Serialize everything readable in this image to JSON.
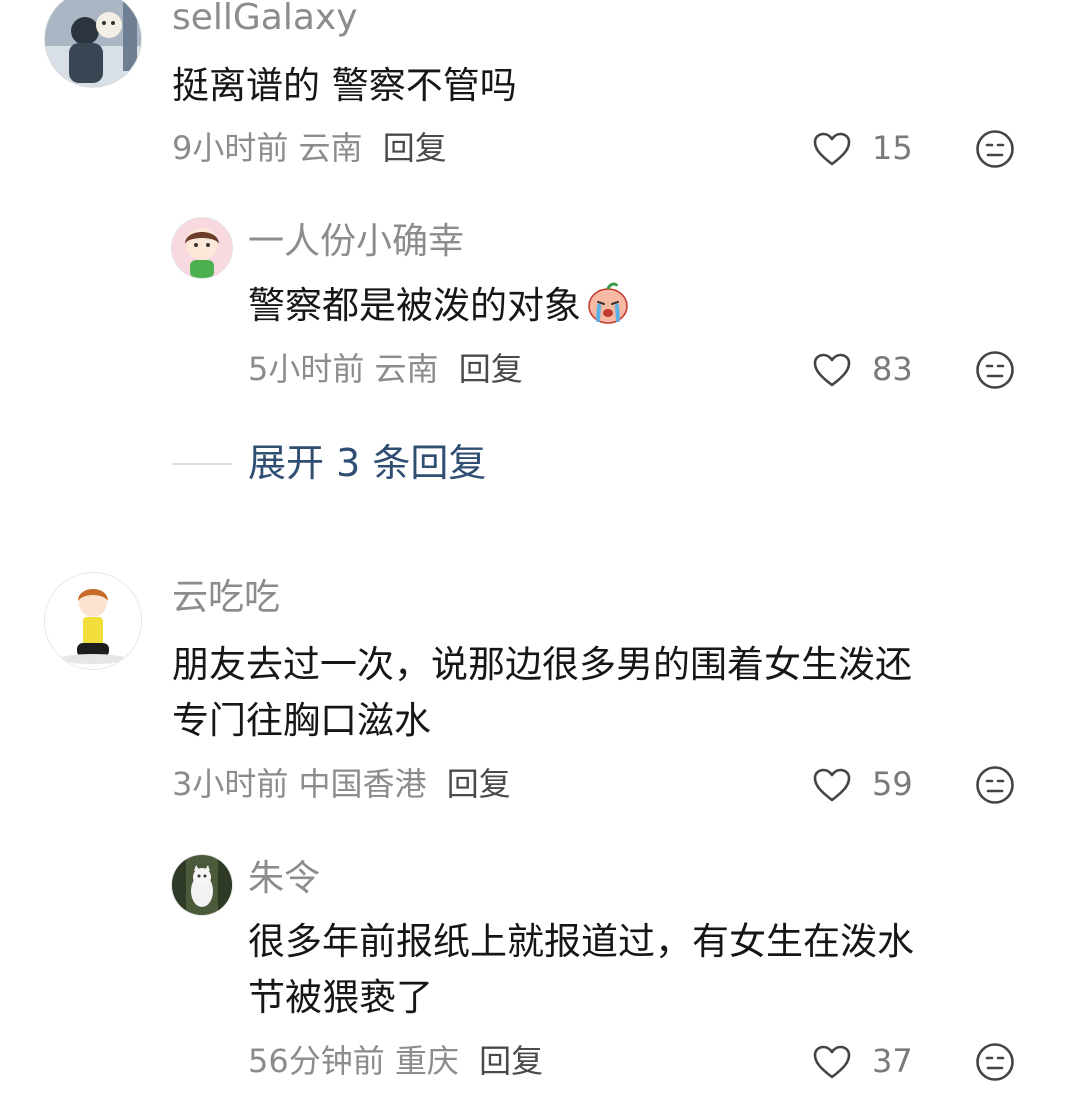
{
  "comments": [
    {
      "user": "sellGalaxy",
      "text": "挺离谱的 警察不管吗",
      "time": "9小时前",
      "location": "云南",
      "reply_label": "回复",
      "likes": "15",
      "replies": [
        {
          "user": "一人份小确幸",
          "text": "警察都是被泼的对象",
          "time": "5小时前",
          "location": "云南",
          "reply_label": "回复",
          "likes": "83"
        }
      ],
      "expand_label": "展开 3 条回复"
    },
    {
      "user": "云吃吃",
      "text_line1": "朋友去过一次，说那边很多男的围着女生泼还",
      "text_line2": "专门往胸口滋水",
      "time": "3小时前",
      "location": "中国香港",
      "reply_label": "回复",
      "likes": "59",
      "replies": [
        {
          "user": "朱令",
          "text_line1": "很多年前报纸上就报道过，有女生在泼水",
          "text_line2": "节被猥亵了",
          "time": "56分钟前",
          "location": "重庆",
          "reply_label": "回复",
          "likes": "37"
        }
      ]
    }
  ]
}
